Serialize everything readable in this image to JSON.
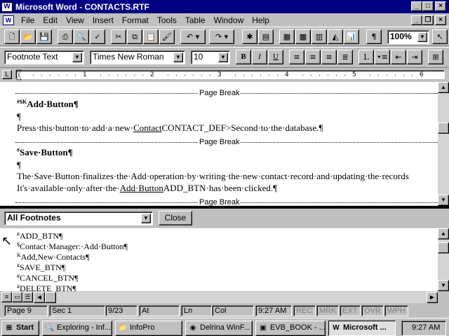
{
  "window": {
    "title": "Microsoft Word - CONTACTS.RTF"
  },
  "menu": {
    "items": [
      "File",
      "Edit",
      "View",
      "Insert",
      "Format",
      "Tools",
      "Table",
      "Window",
      "Help"
    ]
  },
  "toolbar": {
    "zoom": "100%"
  },
  "format": {
    "style": "Footnote Text",
    "font": "Times New Roman",
    "size": "10",
    "bold": "B",
    "italic": "I",
    "underline": "U"
  },
  "ruler": {
    "numbers": [
      "1",
      "2",
      "3",
      "4",
      "5",
      "6"
    ]
  },
  "document": {
    "page_break": "Page Break",
    "add": {
      "marks": "#$K",
      "heading": "Add·Button¶",
      "blank": "¶",
      "p1": "Press·this·button·to·add·a·new·",
      "link": "Contact",
      "code": "CONTACT_DEF>Second",
      "p2": "·to·the·database.¶"
    },
    "save": {
      "marks": "#",
      "heading": "Save·Button¶",
      "blank": "¶",
      "line1": "The·Save·Button·finalizes·the·Add·operation·by·writing·the·new·contact·record·and·updating·the·records",
      "line2a": "It's·available·only·after·the·",
      "link": "Add·Button",
      "code": "ADD_BTN",
      "line2b": "·has·been·clicked.¶"
    }
  },
  "footnotes": {
    "selector": "All Footnotes",
    "close": "Close",
    "items": [
      {
        "mark": "#",
        "text": "ADD_BTN¶"
      },
      {
        "mark": "$",
        "text": "Contact·Manager:·Add·Button¶"
      },
      {
        "mark": "K",
        "text": "Add,New·Contacts¶"
      },
      {
        "mark": "#",
        "text": "SAVE_BTN¶"
      },
      {
        "mark": "#",
        "text": "CANCEL_BTN¶"
      },
      {
        "mark": "#",
        "text": "DELETE_BTN¶"
      }
    ]
  },
  "status": {
    "page": "Page  9",
    "sec": "Sec  1",
    "pages": "9/23",
    "at": "At",
    "ln": "Ln",
    "col": "Col",
    "time": "9:27 AM",
    "rec": "REC",
    "mrk": "MRK",
    "ext": "EXT",
    "ovr": "OVR",
    "wph": "WPH"
  },
  "taskbar": {
    "start": "Start",
    "tasks": [
      "Exploring - Inf...",
      "InfoPro",
      "Delrina WinF...",
      "EVB_BOOK - ...",
      "Microsoft ..."
    ],
    "clock": "9:27 AM"
  }
}
